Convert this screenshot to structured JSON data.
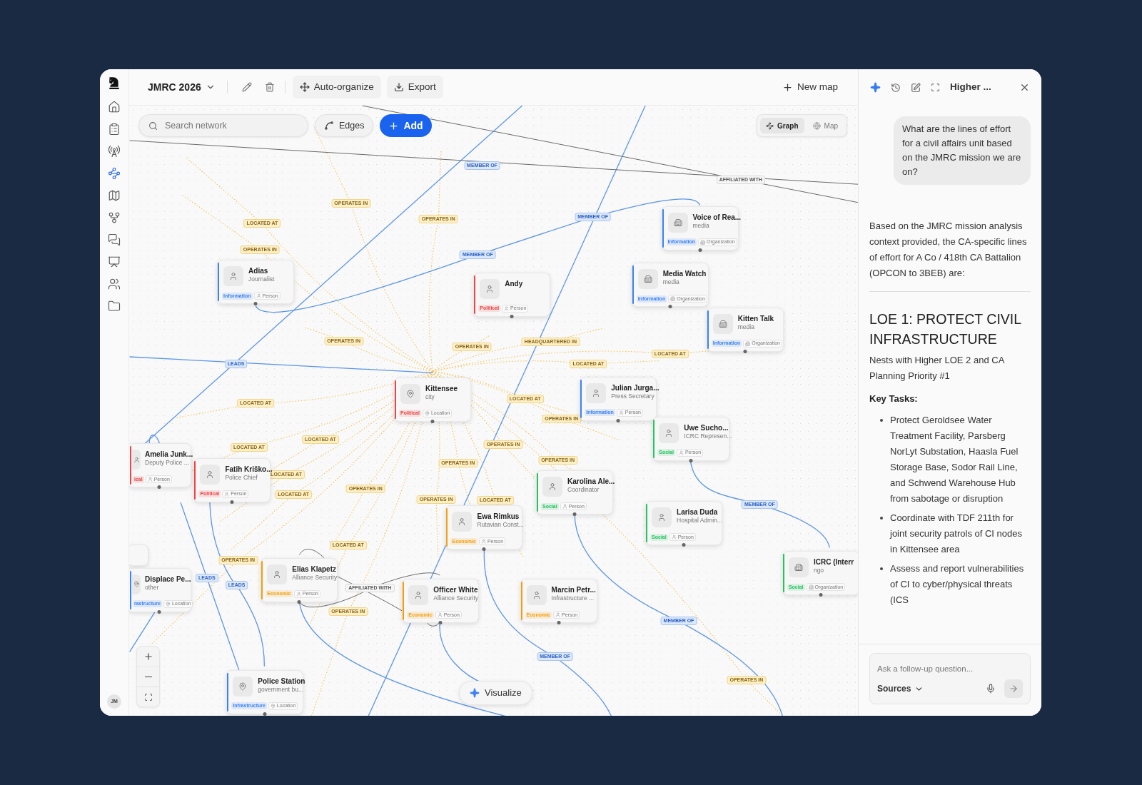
{
  "map": {
    "title": "JMRC 2026"
  },
  "toolbar": {
    "auto_organize": "Auto-organize",
    "export": "Export",
    "new_map": "New map"
  },
  "sidebar": {
    "items": [
      {
        "kind": "home",
        "selected": false
      },
      {
        "kind": "clipboard",
        "selected": false
      },
      {
        "kind": "tower",
        "selected": false
      },
      {
        "kind": "network",
        "selected": true
      },
      {
        "kind": "map",
        "selected": false
      },
      {
        "kind": "branch",
        "selected": false
      },
      {
        "kind": "chat",
        "selected": false
      },
      {
        "kind": "presentation",
        "selected": false
      },
      {
        "kind": "users",
        "selected": false
      },
      {
        "kind": "folder",
        "selected": false
      }
    ],
    "avatar": "JM"
  },
  "canvas": {
    "search": {
      "placeholder": "Search network"
    },
    "edges_button": "Edges",
    "add_button": "Add",
    "view_toggle": [
      {
        "label": "Graph",
        "kind": "graph",
        "selected": true
      },
      {
        "label": "Map",
        "kind": "globe",
        "selected": false
      }
    ],
    "visualize_button": "Visualize"
  },
  "nodes": [
    {
      "title": "Voice of Rea...",
      "subtitle": "media",
      "category": "Information",
      "type": "Organization",
      "kind": "organization",
      "color": "#3b82f6"
    },
    {
      "title": "Adias",
      "subtitle": "Journalist",
      "category": "Information",
      "type": "Person",
      "kind": "person",
      "color": "#3b82f6"
    },
    {
      "title": "Media Watch",
      "subtitle": "media",
      "category": "Information",
      "type": "Organization",
      "kind": "organization",
      "color": "#3b82f6"
    },
    {
      "title": "Andy",
      "category": "Political",
      "type": "Person",
      "kind": "person",
      "color": "#ef4444"
    },
    {
      "title": "Kitten Talk",
      "subtitle": "media",
      "category": "Information",
      "type": "Organization",
      "kind": "organization",
      "color": "#3b82f6"
    },
    {
      "title": "Kittensee",
      "subtitle": "city",
      "category": "Political",
      "type": "Location",
      "kind": "location",
      "color": "#ef4444"
    },
    {
      "title": "Julian Jurga...",
      "subtitle": "Press Secretary",
      "category": "Information",
      "type": "Person",
      "kind": "person",
      "color": "#3b82f6"
    },
    {
      "title": "Uwe Sucho...",
      "subtitle": "ICRC Represen...",
      "category": "Social",
      "type": "Person",
      "kind": "person",
      "color": "#22c55e"
    },
    {
      "title": "Fatih Kriško...",
      "subtitle": "Police Chief",
      "category": "Political",
      "type": "Person",
      "kind": "person",
      "color": "#ef4444"
    },
    {
      "title": "Amelia Junk...",
      "subtitle": "Deputy Police ...",
      "category": "ical",
      "type": "Person",
      "kind": "person",
      "color": "#ef4444"
    },
    {
      "title": "Karolina Ale...",
      "subtitle": "Coordinator",
      "category": "Social",
      "type": "Person",
      "kind": "person",
      "color": "#22c55e"
    },
    {
      "title": "Larisa Duda",
      "subtitle": "Hospital Admin...",
      "category": "Social",
      "type": "Person",
      "kind": "person",
      "color": "#22c55e"
    },
    {
      "title": "Ewa Rimkus",
      "subtitle": "Rutavian Const...",
      "category": "Economic",
      "type": "Person",
      "kind": "person",
      "color": "#f59e0b"
    },
    {
      "title": "ICRC (Interr",
      "subtitle": "ngo",
      "category": "Social",
      "type": "Organization",
      "kind": "organization",
      "color": "#22c55e"
    },
    {
      "title": "Elias Klapetz",
      "subtitle": "Alliance Security",
      "category": "Economic",
      "type": "Person",
      "kind": "person",
      "color": "#f59e0b"
    },
    {
      "title": "Displace Pe...",
      "subtitle": "other",
      "category": "rastructure",
      "type": "Location",
      "kind": "location",
      "color": "#3b82f6"
    },
    {
      "title": "Officer White",
      "subtitle": "Alliance Security",
      "category": "Economic",
      "type": "Person",
      "kind": "person",
      "color": "#f59e0b"
    },
    {
      "title": "Marcin Petr...",
      "subtitle": "Infrastructure ...",
      "category": "Economic",
      "type": "Person",
      "kind": "person",
      "color": "#f59e0b"
    },
    {
      "title": "Police Station",
      "subtitle": "government bu...",
      "category": "Infrastructure",
      "type": "Location",
      "kind": "location",
      "color": "#3b82f6"
    }
  ],
  "edge_labels": [
    {
      "text": "MEMBER OF",
      "kind": "membership"
    },
    {
      "text": "AFFILIATED WITH",
      "kind": "affiliation"
    },
    {
      "text": "OPERATES IN",
      "kind": "activity"
    },
    {
      "text": "LOCATED AT",
      "kind": "activity"
    },
    {
      "text": "OPERATES IN",
      "kind": "activity"
    },
    {
      "text": "MEMBER OF",
      "kind": "membership"
    },
    {
      "text": "OPERATES IN",
      "kind": "activity"
    },
    {
      "text": "MEMBER OF",
      "kind": "membership"
    },
    {
      "text": "OPERATES IN",
      "kind": "activity"
    },
    {
      "text": "OPERATES IN",
      "kind": "activity"
    },
    {
      "text": "HEADQUARTERED IN",
      "kind": "activity"
    },
    {
      "text": "LOCATED AT",
      "kind": "activity"
    },
    {
      "text": "LEADS",
      "kind": "membership"
    },
    {
      "text": "LOCATED AT",
      "kind": "activity"
    },
    {
      "text": "LOCATED AT",
      "kind": "activity"
    },
    {
      "text": "LOCATED AT",
      "kind": "activity"
    },
    {
      "text": "OPERATES IN",
      "kind": "activity"
    },
    {
      "text": "LOCATED AT",
      "kind": "activity"
    },
    {
      "text": "LOCATED AT",
      "kind": "activity"
    },
    {
      "text": "OPERATES IN",
      "kind": "activity"
    },
    {
      "text": "OPERATES IN",
      "kind": "activity"
    },
    {
      "text": "OPERATES IN",
      "kind": "activity"
    },
    {
      "text": "LOCATED AT",
      "kind": "activity"
    },
    {
      "text": "LOCATED AT",
      "kind": "activity"
    },
    {
      "text": "OPERATES IN",
      "kind": "activity"
    },
    {
      "text": "OPERATES IN",
      "kind": "activity"
    },
    {
      "text": "LOCATED AT",
      "kind": "activity"
    },
    {
      "text": "MEMBER OF",
      "kind": "membership"
    },
    {
      "text": "LOCATED AT",
      "kind": "activity"
    },
    {
      "text": "OPERATES IN",
      "kind": "activity"
    },
    {
      "text": "LEADS",
      "kind": "membership"
    },
    {
      "text": "LEADS",
      "kind": "membership"
    },
    {
      "text": "AFFILIATED WITH",
      "kind": "affiliation"
    },
    {
      "text": "OPERATES IN",
      "kind": "activity"
    },
    {
      "text": "MEMBER OF",
      "kind": "membership"
    },
    {
      "text": "MEMBER OF",
      "kind": "membership"
    },
    {
      "text": "OPERATES IN",
      "kind": "activity"
    }
  ],
  "assistant": {
    "title": "Higher ...",
    "question": "What are the lines of effort for a civil affairs unit based on the JMRC mission we are on?",
    "answer_intro": "Based on the JMRC mission analysis context provided, the CA-specific lines of effort for A Co / 418th CA Battalion (OPCON to 3BEB) are:",
    "heading": "LOE 1: PROTECT CIVIL INFRASTRUCTURE",
    "nesting": "Nests with Higher LOE 2 and CA Planning Priority #1",
    "key_tasks_label": "Key Tasks:",
    "tasks": [
      "Protect Geroldsee Water Treatment Facility, Parsberg NorLyt Substation, Haasla Fuel Storage Base, Sodor Rail Line, and Schwend Warehouse Hub from sabotage or disruption",
      "Coordinate with TDF 211th for joint security patrols of CI nodes in Kittensee area",
      "Assess and report vulnerabilities of CI to cyber/physical threats (ICS"
    ],
    "input": {
      "placeholder": "Ask a follow-up question..."
    },
    "sources": "Sources"
  }
}
